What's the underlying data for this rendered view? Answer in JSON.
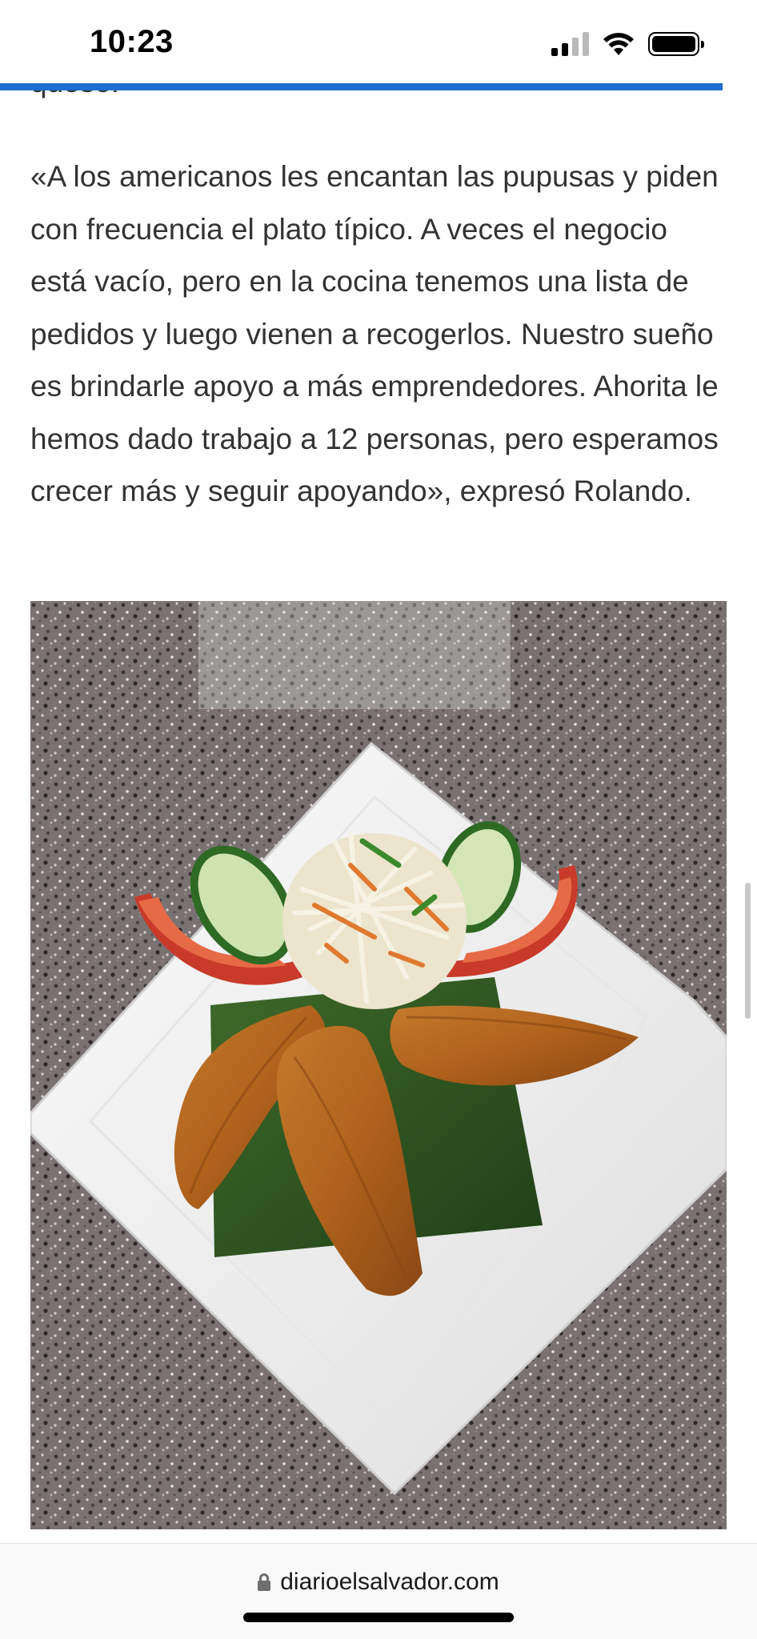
{
  "status_bar": {
    "time": "10:23",
    "icons": [
      "cellular-signal-icon",
      "wifi-icon",
      "battery-icon"
    ]
  },
  "reading_progress": {
    "fraction": 0.955,
    "color": "#1e6fd1"
  },
  "article": {
    "cut_off_text": "queso.",
    "paragraph": "«A los americanos les encantan las pupusas y piden con frecuencia el plato típico. A veces el negocio está vacío, pero en la cocina tenemos una lista de pedidos y luego vienen a recogerlos. Nuestro sueño es brindarle apoyo a más emprendedores. Ahorita le hemos dado trabajo a 12 personas, pero esperamos crecer más y seguir apoyando», expresó Rolando."
  },
  "photo": {
    "subject": "plate-of-empanadas-with-salad"
  },
  "browser": {
    "url": "diarioelsalvador.com",
    "icons": [
      "lock-icon"
    ]
  }
}
